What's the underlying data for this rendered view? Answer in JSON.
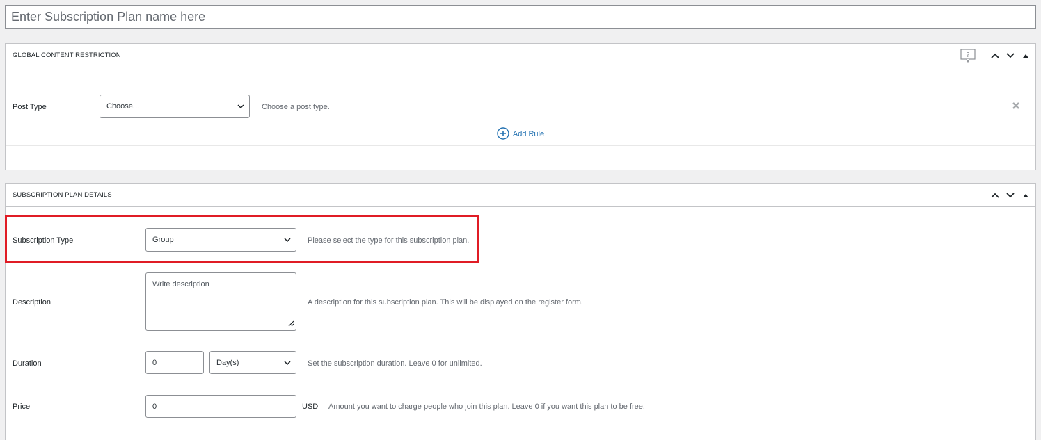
{
  "title_field": {
    "placeholder": "Enter Subscription Plan name here"
  },
  "global_restriction": {
    "title": "GLOBAL CONTENT RESTRICTION",
    "post_type_label": "Post Type",
    "post_type_value": "Choose...",
    "post_type_desc": "Choose a post type.",
    "add_rule_label": "Add Rule"
  },
  "plan_details": {
    "title": "SUBSCRIPTION PLAN DETAILS",
    "subscription_type": {
      "label": "Subscription Type",
      "value": "Group",
      "desc": "Please select the type for this subscription plan."
    },
    "description": {
      "label": "Description",
      "placeholder": "Write description",
      "desc": "A description for this subscription plan. This will be displayed on the register form."
    },
    "duration": {
      "label": "Duration",
      "value": "0",
      "unit": "Day(s)",
      "desc": "Set the subscription duration. Leave 0 for unlimited."
    },
    "price": {
      "label": "Price",
      "value": "0",
      "currency": "USD",
      "desc": "Amount you want to charge people who join this plan. Leave 0 if you want this plan to be free."
    }
  },
  "colors": {
    "highlight": "#e01c25",
    "link": "#2271b1"
  },
  "icons": [
    "help-icon",
    "chevron-up-icon",
    "chevron-down-icon",
    "triangle-up-icon",
    "close-icon",
    "plus-circle-icon",
    "chevron-down-icon",
    "resize-handle-icon"
  ]
}
